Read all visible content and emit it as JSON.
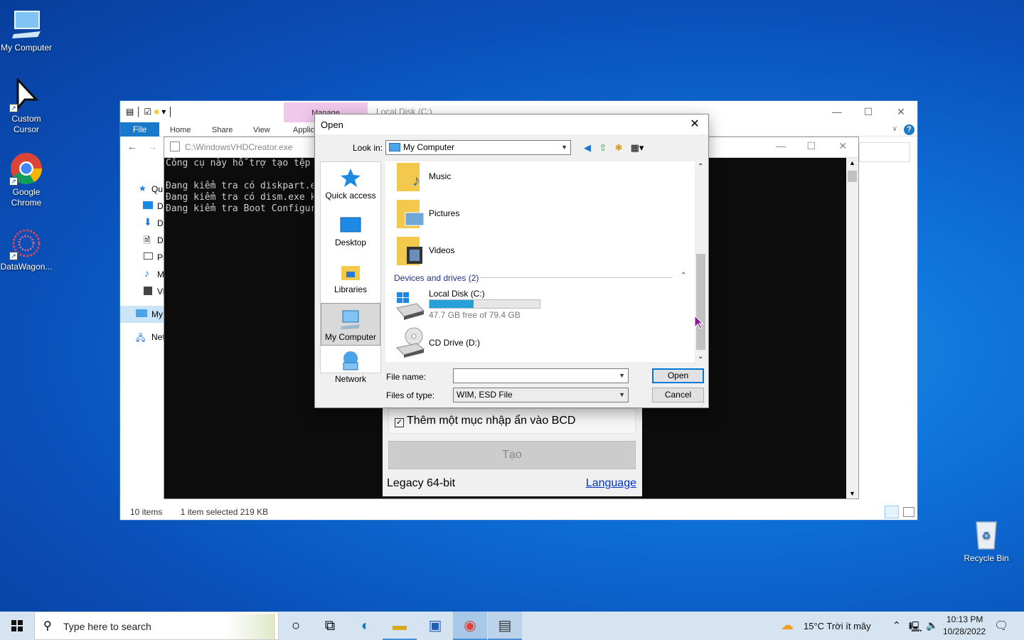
{
  "desktop": {
    "icons": [
      {
        "label": "My Computer"
      },
      {
        "label": "Custom Cursor"
      },
      {
        "label": "Google Chrome"
      },
      {
        "label": "DataWagon..."
      },
      {
        "label": "Recycle Bin"
      }
    ]
  },
  "explorer": {
    "manage_tab": "Manage",
    "title": "Local Disk (C:)",
    "ribbon": {
      "file": "File",
      "home": "Home",
      "share": "Share",
      "view": "View",
      "app": "Applic"
    },
    "nav_items": [
      "Qu",
      "D",
      "D",
      "D",
      "Pi",
      "M",
      "Vi",
      "My",
      "Net"
    ],
    "status": {
      "items": "10 items",
      "selected": "1 item selected  219 KB"
    }
  },
  "console": {
    "title": "C:\\WindowsVHDCreator.exe",
    "lines": [
      "Công cụ này hỗ trợ tạo tệp",
      "",
      "Đang kiểm tra có diskpart.e",
      "Đang kiểm tra có dism.exe k",
      "Đang kiểm tra Boot Configur"
    ]
  },
  "app_panel": {
    "checkbox_label": "Thêm một mục nhập ẩn vào BCD",
    "checkbox_checked": "✓",
    "create_button": "Tạo",
    "mode": "Legacy 64-bit",
    "language_link": "Language"
  },
  "dialog": {
    "title": "Open",
    "look_in_label": "Look in:",
    "look_in_value": "My Computer",
    "places": [
      "Quick access",
      "Desktop",
      "Libraries",
      "My Computer",
      "Network"
    ],
    "folders": [
      "Music",
      "Pictures",
      "Videos"
    ],
    "group_header": "Devices and drives (2)",
    "drives": [
      {
        "name": "Local Disk (C:)",
        "free": "47.7 GB free of 79.4 GB",
        "used_fraction": 0.4
      },
      {
        "name": "CD Drive (D:)"
      }
    ],
    "file_name_label": "File name:",
    "file_name_value": "",
    "file_type_label": "Files of type:",
    "file_type_value": "WIM, ESD File",
    "open_button": "Open",
    "cancel_button": "Cancel"
  },
  "taskbar": {
    "search_placeholder": "Type here to search",
    "weather": "15°C  Trời ít mây",
    "time": "10:13 PM",
    "date": "10/28/2022"
  }
}
